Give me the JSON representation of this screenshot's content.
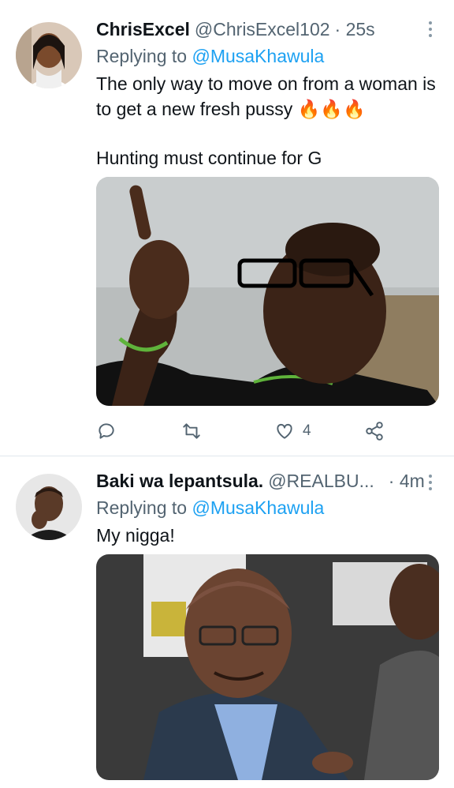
{
  "tweets": [
    {
      "name": "ChrisExcel",
      "handle": "@ChrisExcel102",
      "time": "· 25s",
      "replying_prefix": "Replying to",
      "replying_to": "@MusaKhawula",
      "text_lines": [
        "The only way to move on from a woman is to get a new fresh pussy 🔥🔥🔥",
        "Hunting must continue for G"
      ],
      "actions": {
        "reply_count": "",
        "retweet_count": "",
        "like_count": "4"
      }
    },
    {
      "name": "Baki wa lepantsula.",
      "handle": "@REALBU...",
      "time": "· 4m",
      "replying_prefix": "Replying to",
      "replying_to": "@MusaKhawula",
      "text_lines": [
        "My nigga!"
      ]
    }
  ],
  "icons": [
    "reply-icon",
    "retweet-icon",
    "like-icon",
    "share-icon",
    "more-icon"
  ],
  "colors": {
    "mention": "#1da1f2",
    "secondary_text": "#536471",
    "divider": "#e1e8ed"
  }
}
